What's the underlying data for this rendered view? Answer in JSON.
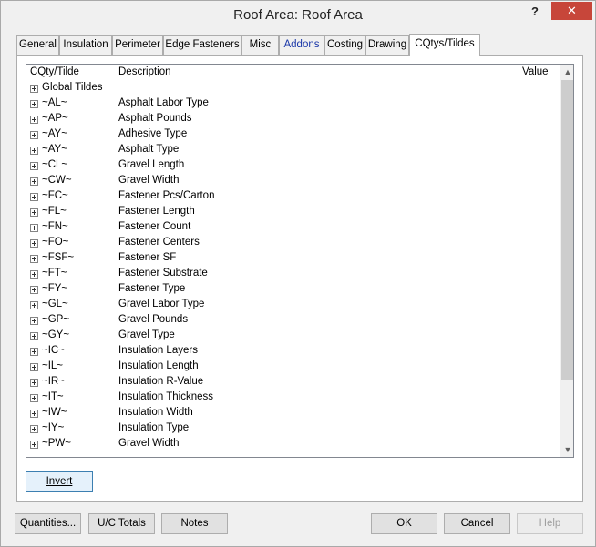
{
  "window": {
    "title": "Roof Area: Roof Area",
    "help_label": "?",
    "close_label": "✕"
  },
  "tabs": [
    {
      "label": "General"
    },
    {
      "label": "Insulation"
    },
    {
      "label": "Perimeter"
    },
    {
      "label": "Edge Fasteners"
    },
    {
      "label": "Misc"
    },
    {
      "label": "Addons"
    },
    {
      "label": "Costing"
    },
    {
      "label": "Drawing"
    },
    {
      "label": "CQtys/Tildes"
    }
  ],
  "grid": {
    "columns": {
      "code": "CQty/Tilde",
      "description": "Description",
      "value": "Value"
    },
    "rows": [
      {
        "code": "Global Tildes",
        "description": ""
      },
      {
        "code": "~AL~",
        "description": "Asphalt Labor Type"
      },
      {
        "code": "~AP~",
        "description": "Asphalt Pounds"
      },
      {
        "code": "~AY~",
        "description": "Adhesive Type"
      },
      {
        "code": "~AY~",
        "description": "Asphalt Type"
      },
      {
        "code": "~CL~",
        "description": "Gravel Length"
      },
      {
        "code": "~CW~",
        "description": "Gravel Width"
      },
      {
        "code": "~FC~",
        "description": "Fastener Pcs/Carton"
      },
      {
        "code": "~FL~",
        "description": "Fastener Length"
      },
      {
        "code": "~FN~",
        "description": "Fastener Count"
      },
      {
        "code": "~FO~",
        "description": "Fastener Centers"
      },
      {
        "code": "~FSF~",
        "description": "Fastener SF"
      },
      {
        "code": "~FT~",
        "description": "Fastener Substrate"
      },
      {
        "code": "~FY~",
        "description": "Fastener Type"
      },
      {
        "code": "~GL~",
        "description": "Gravel Labor Type"
      },
      {
        "code": "~GP~",
        "description": "Gravel Pounds"
      },
      {
        "code": "~GY~",
        "description": "Gravel Type"
      },
      {
        "code": "~IC~",
        "description": "Insulation Layers"
      },
      {
        "code": "~IL~",
        "description": "Insulation Length"
      },
      {
        "code": "~IR~",
        "description": "Insulation R-Value"
      },
      {
        "code": "~IT~",
        "description": "Insulation Thickness"
      },
      {
        "code": "~IW~",
        "description": "Insulation Width"
      },
      {
        "code": "~IY~",
        "description": "Insulation Type"
      },
      {
        "code": "~PW~",
        "description": "Gravel Width"
      }
    ]
  },
  "invert_label": "Invert",
  "bottom_buttons": {
    "quantities": "Quantities...",
    "uc_totals": "U/C Totals",
    "notes": "Notes",
    "ok": "OK",
    "cancel": "Cancel",
    "help": "Help"
  }
}
